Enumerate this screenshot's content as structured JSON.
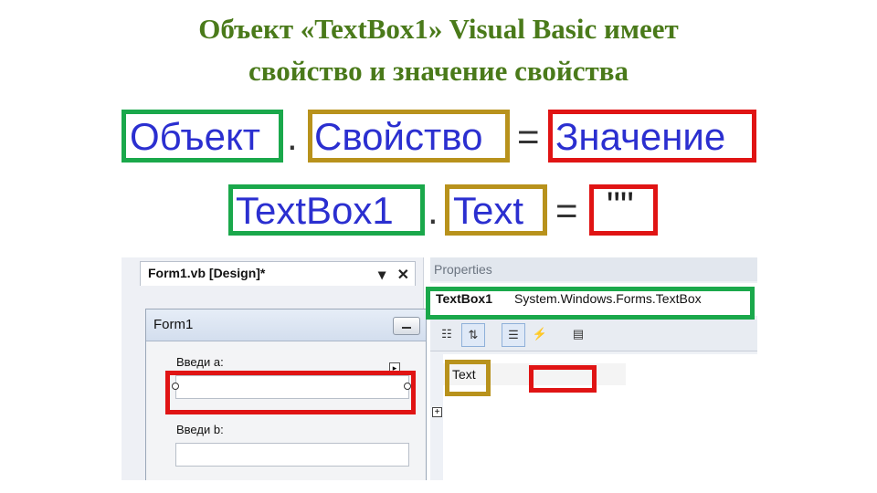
{
  "title": {
    "line1": "Объект «TextBox1» Visual Basic имеет",
    "line2": "свойство и значение свойства"
  },
  "syntax": {
    "object": "Объект",
    "dot": ".",
    "property": "Свойство",
    "equals": "=",
    "value": "Значение"
  },
  "example": {
    "object": "TextBox1",
    "dot": ".",
    "property": "Text",
    "equals": "=",
    "value": "\"\""
  },
  "designer": {
    "tab_label": "Form1.vb [Design]*",
    "tab_pin": "▾",
    "tab_close": "✕",
    "form_title": "Form1",
    "label_a": "Введи a:",
    "label_b": "Введи b:"
  },
  "properties": {
    "header": "Properties",
    "object_name": "TextBox1",
    "object_type": "System.Windows.Forms.TextBox",
    "property_name": "Text",
    "property_value": "",
    "expander_glyph": "+"
  },
  "colors": {
    "title": "#4a7a1a",
    "object_box": "#1aa84b",
    "property_box": "#b8921c",
    "value_box": "#e01414",
    "syntax_text": "#2b2fd0"
  }
}
